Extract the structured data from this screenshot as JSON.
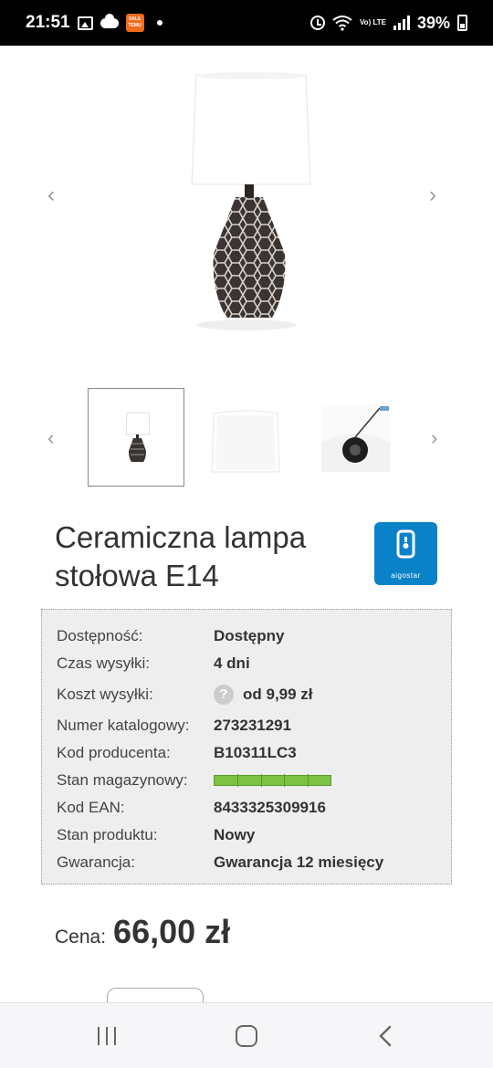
{
  "status_bar": {
    "time": "21:51",
    "temu_label": "SALE TEMU",
    "volte": "Vo) LTE",
    "battery": "39%"
  },
  "gallery": {
    "prev_icon": "chevron-left-icon",
    "next_icon": "chevron-right-icon",
    "prev_glyph": "‹",
    "next_glyph": "›"
  },
  "product": {
    "title": "Ceramiczna lampa stołowa E14",
    "brand": "aigostar",
    "details": [
      {
        "label": "Dostępność:",
        "value": "Dostępny"
      },
      {
        "label": "Czas wysyłki:",
        "value": "4 dni"
      },
      {
        "label": "Koszt wysyłki:",
        "value": "od 9,99 zł",
        "help": "?"
      },
      {
        "label": "Numer katalogowy:",
        "value": "273231291"
      },
      {
        "label": "Kod producenta:",
        "value": "B10311LC3"
      },
      {
        "label": "Stan magazynowy:",
        "value": ""
      },
      {
        "label": "Kod EAN:",
        "value": "8433325309916"
      },
      {
        "label": "Stan produktu:",
        "value": "Nowy"
      },
      {
        "label": "Gwarancja:",
        "value": "Gwarancja 12 miesięcy"
      }
    ],
    "stock_level": 1.0,
    "price_label": "Cena:",
    "price": "66,00 zł"
  },
  "colors": {
    "brand_blue": "#0a82c8",
    "stock_green": "#7dc242",
    "info_bg": "#eeeeee"
  }
}
